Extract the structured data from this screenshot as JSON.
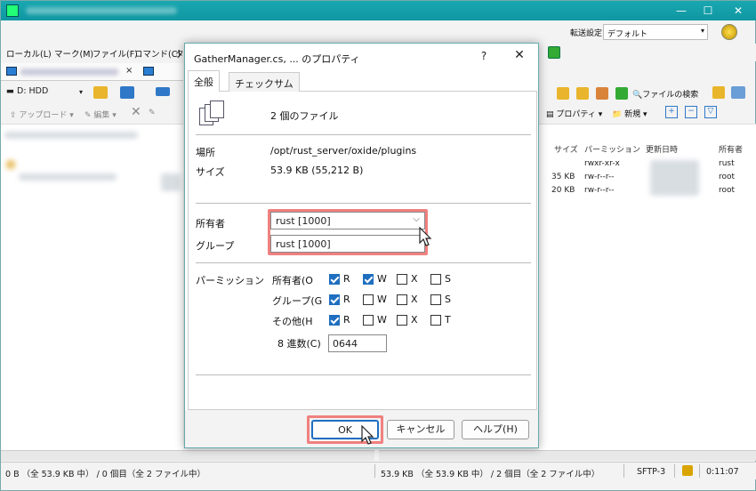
{
  "menu": [
    "ローカル(L)",
    "マーク(M)",
    "ファイル(F)",
    "コマンド(C)",
    "タ"
  ],
  "left": {
    "drive": "D: HDD",
    "upload_label": "アップロード",
    "edit_label": "編集"
  },
  "right": {
    "transfer_setting_label": "転送設定",
    "transfer_setting_value": "デフォルト",
    "find_file_label": "ファイルの検索",
    "properties_label": "プロパティ",
    "new_label": "新規",
    "columns": [
      "サイズ",
      "パーミッション",
      "更新日時",
      "所有者"
    ],
    "rows": [
      {
        "size": "",
        "perm": "rwxr-xr-x",
        "owner": "rust"
      },
      {
        "size": "35 KB",
        "perm": "rw-r--r--",
        "owner": "root"
      },
      {
        "size": "20 KB",
        "perm": "rw-r--r--",
        "owner": "root"
      }
    ]
  },
  "status": {
    "left": "0 B （全 53.9 KB 中） / 0 個目（全 2 ファイル中）",
    "right": "53.9 KB （全 53.9 KB 中） / 2 個目（全 2 ファイル中）",
    "protocol": "SFTP-3",
    "time": "0:11:07"
  },
  "dialog": {
    "title": "GatherManager.cs, ... のプロパティ",
    "help_glyph": "?",
    "close_glyph": "✕",
    "tabs": [
      "全般",
      "チェックサム"
    ],
    "file_count": "2 個のファイル",
    "location_label": "場所",
    "location_value": "/opt/rust_server/oxide/plugins",
    "size_label": "サイズ",
    "size_value": "53.9 KB (55,212 B)",
    "owner_label": "所有者",
    "owner_value": "rust [1000]",
    "group_label": "グループ",
    "group_value": "rust [1000]",
    "permission_label": "パーミッション",
    "perm_rows": [
      {
        "label": "所有者(O",
        "checks": [
          {
            "l": "R",
            "on": true
          },
          {
            "l": "W",
            "on": true
          },
          {
            "l": "X",
            "on": false
          },
          {
            "l": "S",
            "on": false
          }
        ]
      },
      {
        "label": "グループ(G",
        "checks": [
          {
            "l": "R",
            "on": true
          },
          {
            "l": "W",
            "on": false
          },
          {
            "l": "X",
            "on": false
          },
          {
            "l": "S",
            "on": false
          }
        ]
      },
      {
        "label": "その他(H",
        "checks": [
          {
            "l": "R",
            "on": true
          },
          {
            "l": "W",
            "on": false
          },
          {
            "l": "X",
            "on": false
          },
          {
            "l": "T",
            "on": false
          }
        ]
      }
    ],
    "octal_label": "8 進数(C)",
    "octal_value": "0644",
    "ok_label": "OK",
    "cancel_label": "キャンセル",
    "help_label": "ヘルプ(H)"
  }
}
